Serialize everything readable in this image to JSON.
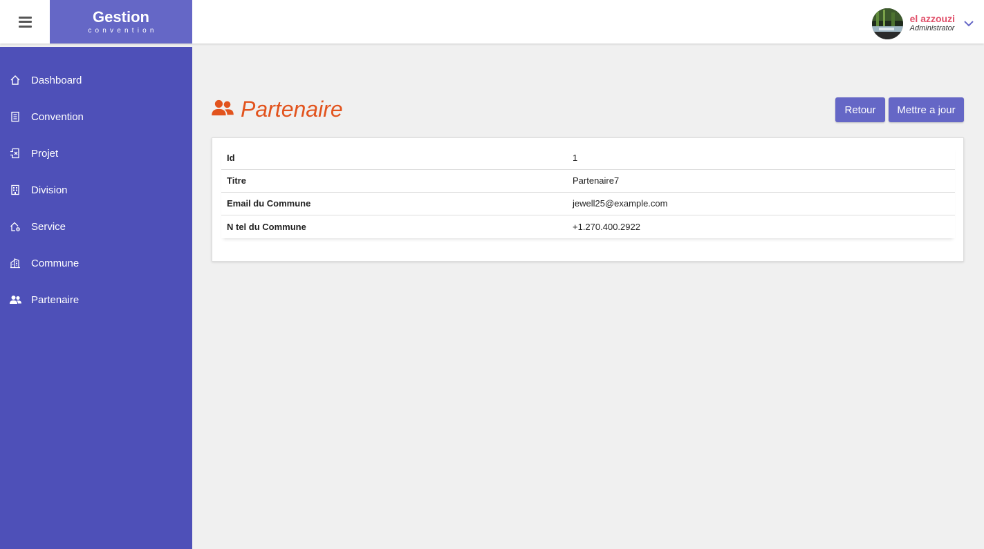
{
  "brand": {
    "title": "Gestion",
    "subtitle": "convention"
  },
  "user": {
    "name": "el azzouzi",
    "role": "Administrator"
  },
  "sidebar": {
    "items": [
      {
        "label": "Dashboard",
        "icon": "home-icon"
      },
      {
        "label": "Convention",
        "icon": "document-icon"
      },
      {
        "label": "Projet",
        "icon": "project-icon"
      },
      {
        "label": "Division",
        "icon": "building-icon"
      },
      {
        "label": "Service",
        "icon": "home-gear-icon"
      },
      {
        "label": "Commune",
        "icon": "city-icon"
      },
      {
        "label": "Partenaire",
        "icon": "users-icon"
      }
    ]
  },
  "page": {
    "title": "Partenaire",
    "title_icon": "users-icon",
    "buttons": {
      "back": "Retour",
      "update": "Mettre a jour"
    }
  },
  "details": [
    {
      "key": "Id",
      "value": "1"
    },
    {
      "key": "Titre",
      "value": "Partenaire7"
    },
    {
      "key": "Email du Commune",
      "value": "jewell25@example.com"
    },
    {
      "key": "N tel du Commune",
      "value": "+1.270.400.2922"
    }
  ],
  "colors": {
    "accent": "#6567c6",
    "sidebar": "#4e50b8",
    "title": "#e2531d",
    "user_name": "#e0506a",
    "background": "#f0f0f0"
  }
}
